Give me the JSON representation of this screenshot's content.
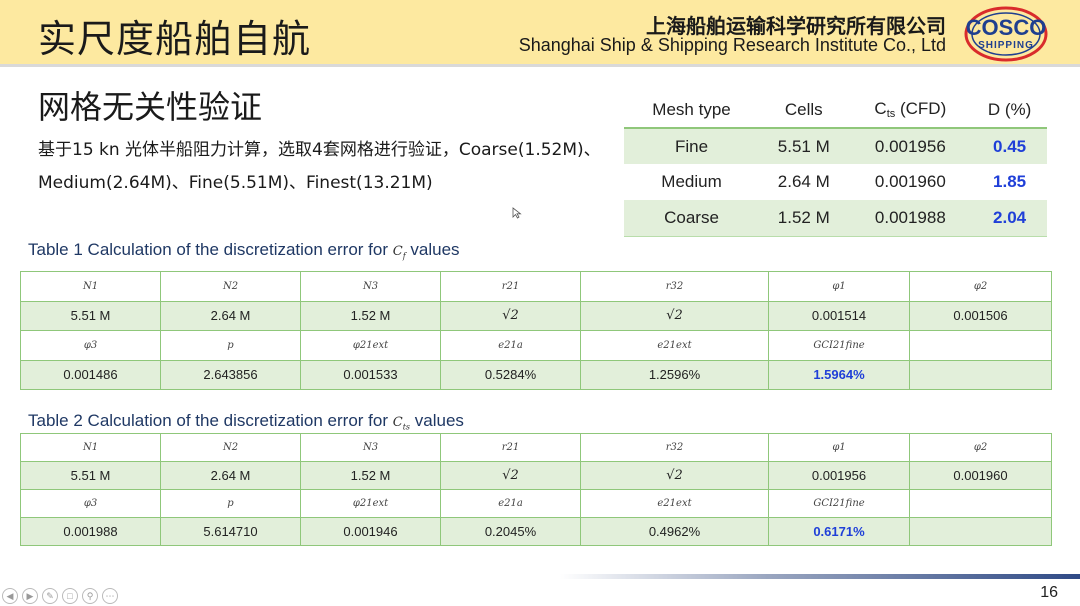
{
  "header": {
    "title": "实尺度船舶自航",
    "org_cn": "上海船舶运输科学研究所有限公司",
    "org_en": "Shanghai Ship & Shipping Research Institute Co., Ltd",
    "logo_top": "COSCO",
    "logo_bottom": "SHIPPING",
    "brand_color": "#1f3f8f",
    "accent_color": "#d92b2b"
  },
  "section": {
    "title": "网格无关性验证",
    "intro": "基于15 kn 光体半船阻力计算，选取4套网格进行验证，Coarse(1.52M)、Medium(2.64M)、Fine(5.51M)、Finest(13.21M)"
  },
  "mesh_table": {
    "headers": {
      "mesh": "Mesh type",
      "cells": "Cells",
      "ct_main": "C",
      "ct_sub": "ts",
      "ct_tail": " (CFD)",
      "d": "D (%)"
    },
    "rows": [
      {
        "mesh": "Fine",
        "cells": "5.51 M",
        "ct": "0.001956",
        "d": "0.45"
      },
      {
        "mesh": "Medium",
        "cells": "2.64 M",
        "ct": "0.001960",
        "d": "1.85"
      },
      {
        "mesh": "Coarse",
        "cells": "1.52 M",
        "ct": "0.001988",
        "d": "2.04"
      }
    ]
  },
  "table1": {
    "caption_pre": "Table 1 Calculation of the discretization error for ",
    "caption_sym": "C",
    "caption_sym_sub": "f",
    "caption_post": " values",
    "row1_headers": [
      "N1",
      "N2",
      "N3",
      "r21",
      "r32",
      "φ1",
      "φ2"
    ],
    "row1_values": [
      "5.51 M",
      "2.64 M",
      "1.52 M",
      "√2",
      "√2",
      "0.001514",
      "0.001506"
    ],
    "row2_headers": [
      "φ3",
      "p",
      "φ21ext",
      "e21a",
      "e21ext",
      "GCI21fine",
      ""
    ],
    "row2_values": [
      "0.001486",
      "2.643856",
      "0.001533",
      "0.5284%",
      "1.2596%",
      "1.5964%",
      ""
    ]
  },
  "table2": {
    "caption_pre": "Table 2 Calculation of the discretization error for ",
    "caption_sym": "C",
    "caption_sym_sub": "ts",
    "caption_post": " values",
    "row1_headers": [
      "N1",
      "N2",
      "N3",
      "r21",
      "r32",
      "φ1",
      "φ2"
    ],
    "row1_values": [
      "5.51 M",
      "2.64 M",
      "1.52 M",
      "√2",
      "√2",
      "0.001956",
      "0.001960"
    ],
    "row2_headers": [
      "φ3",
      "p",
      "φ21ext",
      "e21a",
      "e21ext",
      "GCI21fine",
      ""
    ],
    "row2_values": [
      "0.001988",
      "5.614710",
      "0.001946",
      "0.2045%",
      "0.4962%",
      "0.6171%",
      ""
    ]
  },
  "footer": {
    "page_number": "16",
    "nav_icons": [
      "prev-icon",
      "next-icon",
      "pen-icon",
      "copy-icon",
      "zoom-icon",
      "more-icon"
    ]
  }
}
